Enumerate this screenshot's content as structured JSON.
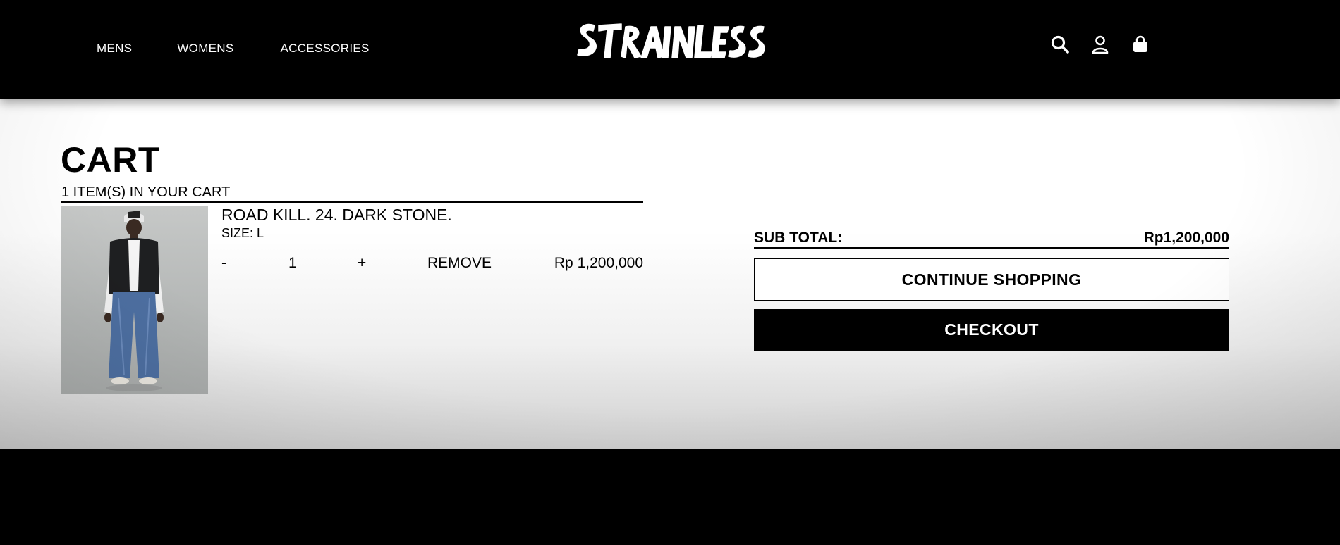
{
  "header": {
    "nav": [
      "MENS",
      "WOMENS",
      "ACCESSORIES"
    ],
    "logo_text": "STRAINLESS",
    "icons": [
      "search-icon",
      "user-icon",
      "shopping-bag-icon"
    ]
  },
  "cart": {
    "title": "CART",
    "count_text": "1 ITEM(S) IN YOUR CART",
    "items": [
      {
        "name": "ROAD KILL. 24. DARK STONE.",
        "size": "SIZE: L",
        "minus": "-",
        "quantity": "1",
        "plus": "+",
        "remove": "REMOVE",
        "price": "Rp 1,200,000"
      }
    ]
  },
  "summary": {
    "subtotal_label": "SUB TOTAL:",
    "subtotal_value": "Rp1,200,000",
    "continue_label": "CONTINUE SHOPPING",
    "checkout_label": "CHECKOUT"
  },
  "colors": {
    "primary": "#000000",
    "background": "#ffffff"
  }
}
